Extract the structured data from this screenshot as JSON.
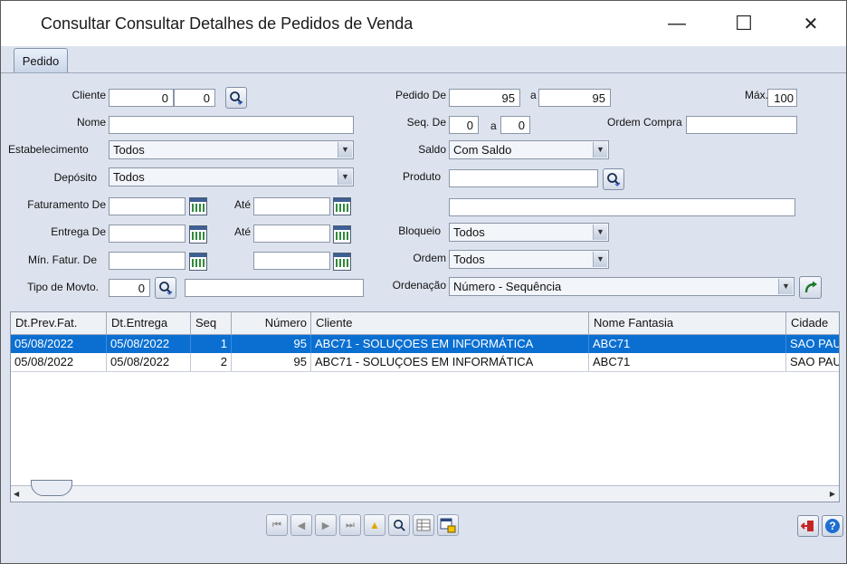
{
  "window": {
    "title": "Consultar Consultar Detalhes de Pedidos de Venda",
    "minimize": "—",
    "maximize": "☐",
    "close": "✕"
  },
  "tabs": [
    {
      "label": "Pedido"
    }
  ],
  "form": {
    "cliente_label": "Cliente",
    "cliente_value1": "0",
    "cliente_value2": "0",
    "nome_label": "Nome",
    "nome_value": "",
    "estabelecimento_label": "Estabelecimento",
    "estabelecimento_value": "Todos",
    "deposito_label": "Depósito",
    "deposito_value": "Todos",
    "faturamento_de_label": "Faturamento De",
    "ate1_label": "Até",
    "entrega_de_label": "Entrega De",
    "ate2_label": "Até",
    "min_fatur_label": "Mín. Fatur. De",
    "tipo_movto_label": "Tipo de Movto.",
    "tipo_movto_value": "0",
    "pedido_de_label": "Pedido De",
    "pedido_de_value": "95",
    "pedido_a_label": "a",
    "pedido_a_value": "95",
    "max_label": "Máx.",
    "max_value": "100",
    "seq_de_label": "Seq. De",
    "seq_de_value": "0",
    "seq_a_label": "a",
    "seq_a_value": "0",
    "ordem_compra_label": "Ordem Compra",
    "saldo_label": "Saldo",
    "saldo_value": "Com Saldo",
    "produto_label": "Produto",
    "bloqueio_label": "Bloqueio",
    "bloqueio_value": "Todos",
    "ordem_label": "Ordem",
    "ordem_value": "Todos",
    "ordenacao_label": "Ordenação",
    "ordenacao_value": "Número - Sequência"
  },
  "table": {
    "columns": [
      "Dt.Prev.Fat.",
      "Dt.Entrega",
      "Seq",
      "Número",
      "Cliente",
      "Nome Fantasia",
      "Cidade"
    ],
    "rows": [
      [
        "05/08/2022",
        "05/08/2022",
        "1",
        "95",
        "ABC71 - SOLUÇOES EM INFORMÁTICA",
        "ABC71",
        "SAO PAU"
      ],
      [
        "05/08/2022",
        "05/08/2022",
        "2",
        "95",
        "ABC71 - SOLUÇOES EM INFORMÁTICA",
        "ABC71",
        "SAO PAU"
      ]
    ],
    "selected_row": 0
  },
  "icons": {
    "search": "search-icon",
    "calendar": "calendar-icon",
    "refresh": "refresh-arrow-icon",
    "exit": "exit-icon",
    "help": "help-icon"
  },
  "colors": {
    "selection": "#0a6fd1",
    "panel": "#dde3ee"
  }
}
